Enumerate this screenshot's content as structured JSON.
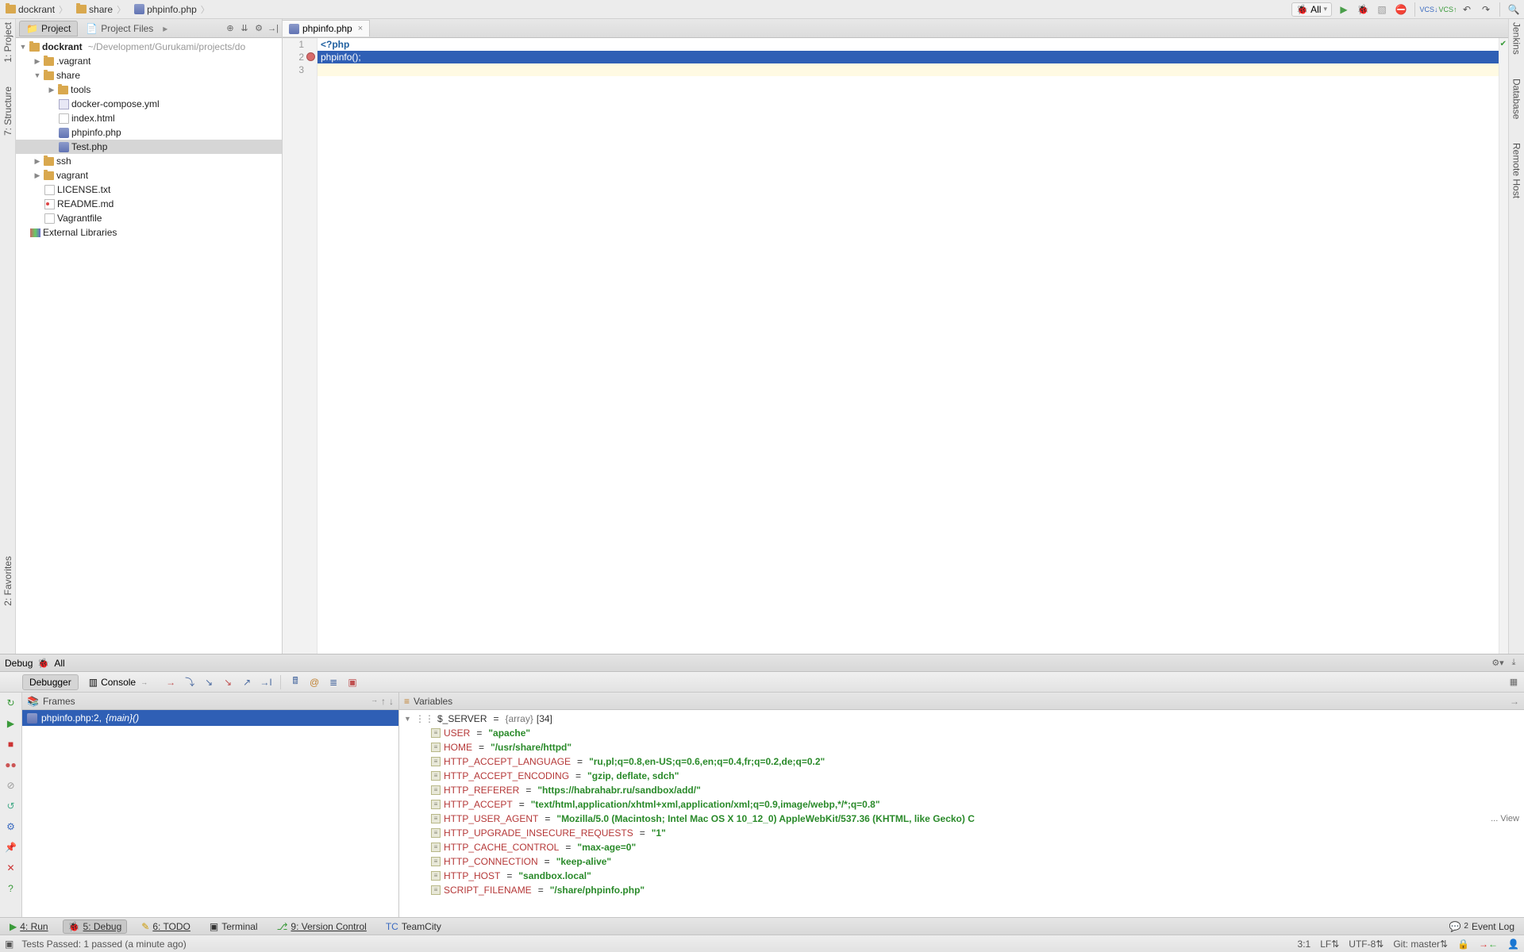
{
  "breadcrumb": [
    "dockrant",
    "share",
    "phpinfo.php"
  ],
  "runConfig": "All",
  "projectTabs": {
    "project": "Project",
    "files": "Project Files"
  },
  "tree": {
    "root": "dockrant",
    "rootPath": "~/Development/Gurukami/projects/do",
    "vagrant": ".vagrant",
    "share": "share",
    "tools": "tools",
    "dcompose": "docker-compose.yml",
    "index": "index.html",
    "phpinfo": "phpinfo.php",
    "test": "Test.php",
    "ssh": "ssh",
    "vagrantDir": "vagrant",
    "license": "LICENSE.txt",
    "readme": "README.md",
    "vagrantfile": "Vagrantfile",
    "extlib": "External Libraries"
  },
  "editor": {
    "tab": "phpinfo.php",
    "lines": {
      "l1": "<?php",
      "l2": "phpinfo();",
      "l3": ""
    }
  },
  "debug": {
    "title": "Debug",
    "config": "All",
    "tabs": {
      "debugger": "Debugger",
      "console": "Console"
    },
    "frames": "Frames",
    "variables": "Variables",
    "frame0": {
      "file": "phpinfo.php:2,",
      "func": "{main}()"
    },
    "server": {
      "name": "$_SERVER",
      "type": "{array}",
      "count": "[34]"
    },
    "vars": [
      {
        "k": "USER",
        "v": "\"apache\""
      },
      {
        "k": "HOME",
        "v": "\"/usr/share/httpd\""
      },
      {
        "k": "HTTP_ACCEPT_LANGUAGE",
        "v": "\"ru,pl;q=0.8,en-US;q=0.6,en;q=0.4,fr;q=0.2,de;q=0.2\""
      },
      {
        "k": "HTTP_ACCEPT_ENCODING",
        "v": "\"gzip, deflate, sdch\""
      },
      {
        "k": "HTTP_REFERER",
        "v": "\"https://habrahabr.ru/sandbox/add/\""
      },
      {
        "k": "HTTP_ACCEPT",
        "v": "\"text/html,application/xhtml+xml,application/xml;q=0.9,image/webp,*/*;q=0.8\""
      },
      {
        "k": "HTTP_USER_AGENT",
        "v": "\"Mozilla/5.0 (Macintosh; Intel Mac OS X 10_12_0) AppleWebKit/537.36 (KHTML, like Gecko) C",
        "view": "... View"
      },
      {
        "k": "HTTP_UPGRADE_INSECURE_REQUESTS",
        "v": "\"1\""
      },
      {
        "k": "HTTP_CACHE_CONTROL",
        "v": "\"max-age=0\""
      },
      {
        "k": "HTTP_CONNECTION",
        "v": "\"keep-alive\""
      },
      {
        "k": "HTTP_HOST",
        "v": "\"sandbox.local\""
      },
      {
        "k": "SCRIPT_FILENAME",
        "v": "\"/share/phpinfo.php\""
      }
    ]
  },
  "bottom": {
    "run": "4: Run",
    "debug": "5: Debug",
    "todo": "6: TODO",
    "terminal": "Terminal",
    "vcs": "9: Version Control",
    "teamcity": "TeamCity",
    "eventlog": "Event Log",
    "eventbadge": "2"
  },
  "status": {
    "tests": "Tests Passed: 1 passed (a minute ago)",
    "pos": "3:1",
    "lf": "LF",
    "enc": "UTF-8",
    "git": "Git: master"
  },
  "sideLabels": {
    "project": "1: Project",
    "structure": "7: Structure",
    "favorites": "2: Favorites",
    "jenkins": "Jenkins",
    "database": "Database",
    "remote": "Remote Host"
  }
}
